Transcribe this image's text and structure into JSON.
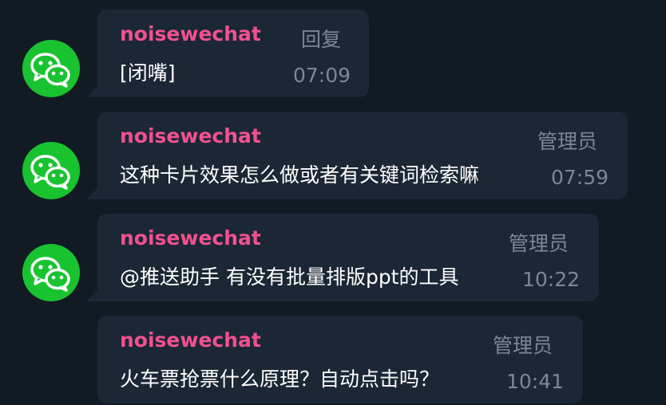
{
  "messages": [
    {
      "sender": "noisewechat",
      "tag": "回复",
      "text": "[闭嘴]",
      "time": "07:09"
    },
    {
      "sender": "noisewechat",
      "tag": "管理员",
      "text": "这种卡片效果怎么做或者有关键词检索嘛",
      "time": "07:59"
    },
    {
      "sender": "noisewechat",
      "tag": "管理员",
      "text": "@推送助手 有没有批量排版ppt的工具",
      "time": "10:22"
    },
    {
      "sender": "noisewechat",
      "tag": "管理员",
      "text": "火车票抢票什么原理？自动点击吗？",
      "time": "10:41"
    }
  ],
  "colors": {
    "background": "#121a24",
    "bubble": "#1b2734",
    "sender": "#f0518f",
    "muted": "#7b8794",
    "avatar": "#19c32f"
  },
  "icons": {
    "avatar": "wechat-icon"
  }
}
